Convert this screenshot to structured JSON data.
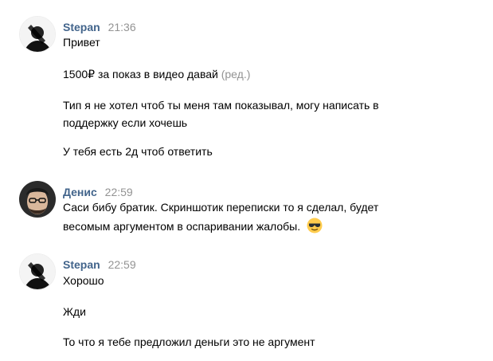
{
  "messages": [
    {
      "author": "Stepan",
      "time": "21:36",
      "lines": [
        "Привет",
        "1500₽ за показ в видео давай",
        "Тип я не хотел чтоб ты меня там показывал, могу написать в",
        "поддержку если хочешь",
        "У тебя есть 2д чтоб ответить"
      ],
      "edited_label": "(ред.)"
    },
    {
      "author": "Денис",
      "time": "22:59",
      "lines": [
        "Саси бибу братик. Скриншотик переписки то я сделал, будет",
        "весомым аргументом в оспаривании жалобы."
      ],
      "emoji": "sunglasses-emoji"
    },
    {
      "author": "Stepan",
      "time": "22:59",
      "lines": [
        "Хорошо",
        "Жди",
        "То что я тебе предложил деньги это не аргумент"
      ]
    }
  ],
  "colors": {
    "author": "#42648b",
    "time": "#939393",
    "text": "#000000",
    "emoji_face": "#ffcc4d"
  }
}
